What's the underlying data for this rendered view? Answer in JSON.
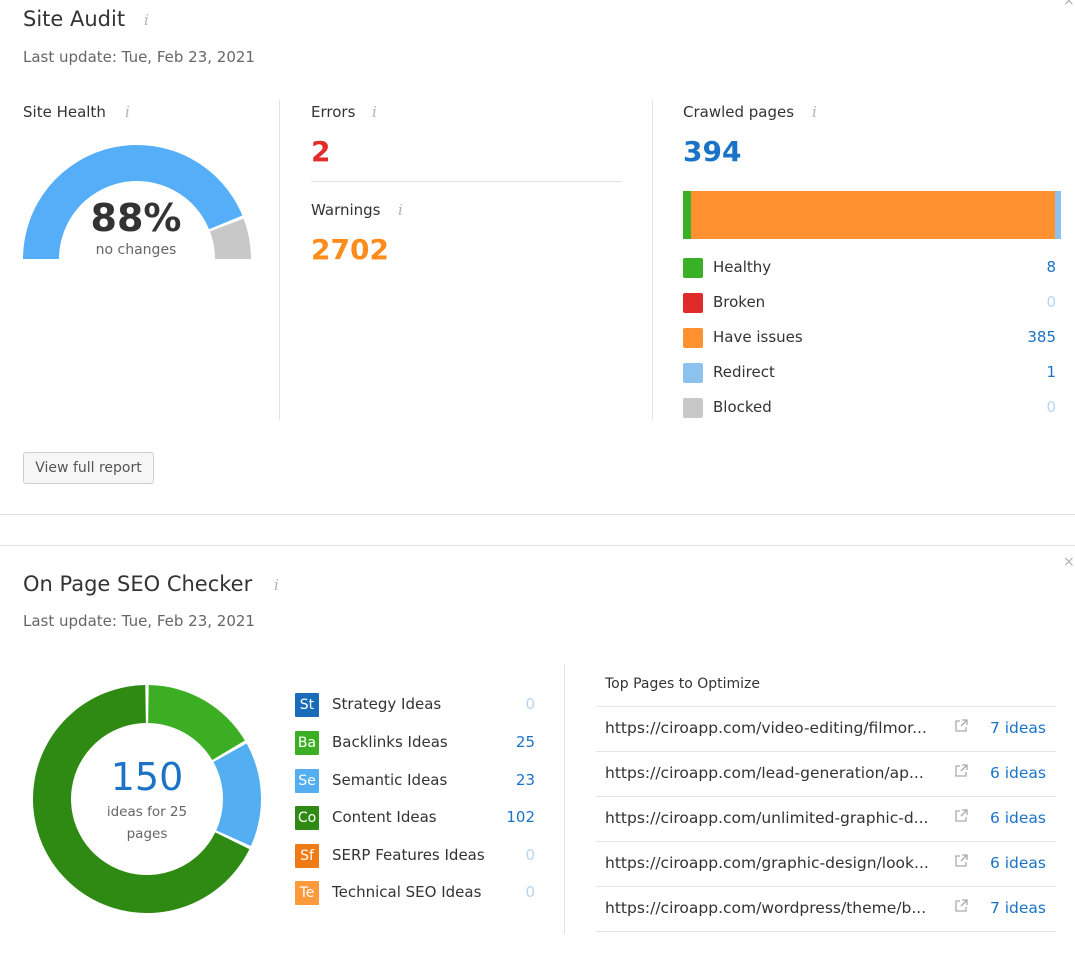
{
  "site_audit": {
    "title": "Site Audit",
    "info": "i",
    "last_update": "Last update: Tue, Feb 23, 2021",
    "site_health": {
      "label": "Site Health",
      "value": "88%",
      "health_fraction": 0.88,
      "note": "no changes",
      "colors": {
        "fill": "#55aef7",
        "rest": "#c8c8c8"
      }
    },
    "errors": {
      "label": "Errors",
      "value": "2",
      "color": "#e12b2b"
    },
    "warnings": {
      "label": "Warnings",
      "value": "2702",
      "color": "#ff8c1a"
    },
    "crawled": {
      "label": "Crawled pages",
      "value": "394",
      "legend": [
        {
          "label": "Healthy",
          "count": "8",
          "color": "#3ab026"
        },
        {
          "label": "Broken",
          "count": "0",
          "color": "#e12b2b"
        },
        {
          "label": "Have issues",
          "count": "385",
          "color": "#ff9130"
        },
        {
          "label": "Redirect",
          "count": "1",
          "color": "#8cc2ee"
        },
        {
          "label": "Blocked",
          "count": "0",
          "color": "#c8c8c8"
        }
      ]
    },
    "button": "View full report",
    "close": "×"
  },
  "on_page_seo": {
    "title": "On Page SEO Checker",
    "info": "i",
    "last_update": "Last update: Tue, Feb 23, 2021",
    "donut": {
      "total": "150",
      "caption_line1": "ideas for 25",
      "caption_line2": "pages"
    },
    "ideas": [
      {
        "badge": "St",
        "label": "Strategy Ideas",
        "count": "0",
        "color": "#1b6cb8"
      },
      {
        "badge": "Ba",
        "label": "Backlinks Ideas",
        "count": "25",
        "color": "#3cae23"
      },
      {
        "badge": "Se",
        "label": "Semantic Ideas",
        "count": "23",
        "color": "#54aef2"
      },
      {
        "badge": "Co",
        "label": "Content Ideas",
        "count": "102",
        "color": "#2e8a12"
      },
      {
        "badge": "Sf",
        "label": "SERP Features Ideas",
        "count": "0",
        "color": "#f07b14"
      },
      {
        "badge": "Te",
        "label": "Technical SEO Ideas",
        "count": "0",
        "color": "#ff9a3c"
      }
    ],
    "top_pages": {
      "title": "Top Pages to Optimize",
      "rows": [
        {
          "url": "https://ciroapp.com/video-editing/filmor...",
          "ideas": "7 ideas"
        },
        {
          "url": "https://ciroapp.com/lead-generation/ap...",
          "ideas": "6 ideas"
        },
        {
          "url": "https://ciroapp.com/unlimited-graphic-d...",
          "ideas": "6 ideas"
        },
        {
          "url": "https://ciroapp.com/graphic-design/look...",
          "ideas": "6 ideas"
        },
        {
          "url": "https://ciroapp.com/wordpress/theme/b...",
          "ideas": "7 ideas"
        }
      ]
    },
    "close": "×"
  }
}
